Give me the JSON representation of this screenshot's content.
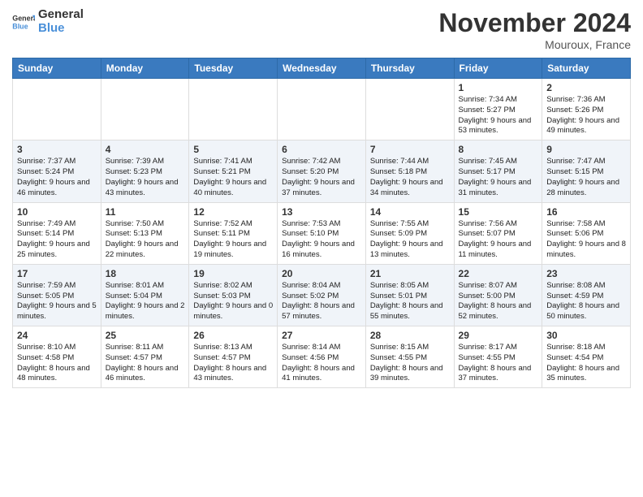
{
  "header": {
    "logo": {
      "general": "General",
      "blue": "Blue"
    },
    "title": "November 2024",
    "location": "Mouroux, France"
  },
  "weekdays": [
    "Sunday",
    "Monday",
    "Tuesday",
    "Wednesday",
    "Thursday",
    "Friday",
    "Saturday"
  ],
  "weeks": [
    {
      "days": [
        null,
        null,
        null,
        null,
        null,
        {
          "num": "1",
          "sunrise": "Sunrise: 7:34 AM",
          "sunset": "Sunset: 5:27 PM",
          "daylight": "Daylight: 9 hours and 53 minutes."
        },
        {
          "num": "2",
          "sunrise": "Sunrise: 7:36 AM",
          "sunset": "Sunset: 5:26 PM",
          "daylight": "Daylight: 9 hours and 49 minutes."
        }
      ]
    },
    {
      "days": [
        {
          "num": "3",
          "sunrise": "Sunrise: 7:37 AM",
          "sunset": "Sunset: 5:24 PM",
          "daylight": "Daylight: 9 hours and 46 minutes."
        },
        {
          "num": "4",
          "sunrise": "Sunrise: 7:39 AM",
          "sunset": "Sunset: 5:23 PM",
          "daylight": "Daylight: 9 hours and 43 minutes."
        },
        {
          "num": "5",
          "sunrise": "Sunrise: 7:41 AM",
          "sunset": "Sunset: 5:21 PM",
          "daylight": "Daylight: 9 hours and 40 minutes."
        },
        {
          "num": "6",
          "sunrise": "Sunrise: 7:42 AM",
          "sunset": "Sunset: 5:20 PM",
          "daylight": "Daylight: 9 hours and 37 minutes."
        },
        {
          "num": "7",
          "sunrise": "Sunrise: 7:44 AM",
          "sunset": "Sunset: 5:18 PM",
          "daylight": "Daylight: 9 hours and 34 minutes."
        },
        {
          "num": "8",
          "sunrise": "Sunrise: 7:45 AM",
          "sunset": "Sunset: 5:17 PM",
          "daylight": "Daylight: 9 hours and 31 minutes."
        },
        {
          "num": "9",
          "sunrise": "Sunrise: 7:47 AM",
          "sunset": "Sunset: 5:15 PM",
          "daylight": "Daylight: 9 hours and 28 minutes."
        }
      ]
    },
    {
      "days": [
        {
          "num": "10",
          "sunrise": "Sunrise: 7:49 AM",
          "sunset": "Sunset: 5:14 PM",
          "daylight": "Daylight: 9 hours and 25 minutes."
        },
        {
          "num": "11",
          "sunrise": "Sunrise: 7:50 AM",
          "sunset": "Sunset: 5:13 PM",
          "daylight": "Daylight: 9 hours and 22 minutes."
        },
        {
          "num": "12",
          "sunrise": "Sunrise: 7:52 AM",
          "sunset": "Sunset: 5:11 PM",
          "daylight": "Daylight: 9 hours and 19 minutes."
        },
        {
          "num": "13",
          "sunrise": "Sunrise: 7:53 AM",
          "sunset": "Sunset: 5:10 PM",
          "daylight": "Daylight: 9 hours and 16 minutes."
        },
        {
          "num": "14",
          "sunrise": "Sunrise: 7:55 AM",
          "sunset": "Sunset: 5:09 PM",
          "daylight": "Daylight: 9 hours and 13 minutes."
        },
        {
          "num": "15",
          "sunrise": "Sunrise: 7:56 AM",
          "sunset": "Sunset: 5:07 PM",
          "daylight": "Daylight: 9 hours and 11 minutes."
        },
        {
          "num": "16",
          "sunrise": "Sunrise: 7:58 AM",
          "sunset": "Sunset: 5:06 PM",
          "daylight": "Daylight: 9 hours and 8 minutes."
        }
      ]
    },
    {
      "days": [
        {
          "num": "17",
          "sunrise": "Sunrise: 7:59 AM",
          "sunset": "Sunset: 5:05 PM",
          "daylight": "Daylight: 9 hours and 5 minutes."
        },
        {
          "num": "18",
          "sunrise": "Sunrise: 8:01 AM",
          "sunset": "Sunset: 5:04 PM",
          "daylight": "Daylight: 9 hours and 2 minutes."
        },
        {
          "num": "19",
          "sunrise": "Sunrise: 8:02 AM",
          "sunset": "Sunset: 5:03 PM",
          "daylight": "Daylight: 9 hours and 0 minutes."
        },
        {
          "num": "20",
          "sunrise": "Sunrise: 8:04 AM",
          "sunset": "Sunset: 5:02 PM",
          "daylight": "Daylight: 8 hours and 57 minutes."
        },
        {
          "num": "21",
          "sunrise": "Sunrise: 8:05 AM",
          "sunset": "Sunset: 5:01 PM",
          "daylight": "Daylight: 8 hours and 55 minutes."
        },
        {
          "num": "22",
          "sunrise": "Sunrise: 8:07 AM",
          "sunset": "Sunset: 5:00 PM",
          "daylight": "Daylight: 8 hours and 52 minutes."
        },
        {
          "num": "23",
          "sunrise": "Sunrise: 8:08 AM",
          "sunset": "Sunset: 4:59 PM",
          "daylight": "Daylight: 8 hours and 50 minutes."
        }
      ]
    },
    {
      "days": [
        {
          "num": "24",
          "sunrise": "Sunrise: 8:10 AM",
          "sunset": "Sunset: 4:58 PM",
          "daylight": "Daylight: 8 hours and 48 minutes."
        },
        {
          "num": "25",
          "sunrise": "Sunrise: 8:11 AM",
          "sunset": "Sunset: 4:57 PM",
          "daylight": "Daylight: 8 hours and 46 minutes."
        },
        {
          "num": "26",
          "sunrise": "Sunrise: 8:13 AM",
          "sunset": "Sunset: 4:57 PM",
          "daylight": "Daylight: 8 hours and 43 minutes."
        },
        {
          "num": "27",
          "sunrise": "Sunrise: 8:14 AM",
          "sunset": "Sunset: 4:56 PM",
          "daylight": "Daylight: 8 hours and 41 minutes."
        },
        {
          "num": "28",
          "sunrise": "Sunrise: 8:15 AM",
          "sunset": "Sunset: 4:55 PM",
          "daylight": "Daylight: 8 hours and 39 minutes."
        },
        {
          "num": "29",
          "sunrise": "Sunrise: 8:17 AM",
          "sunset": "Sunset: 4:55 PM",
          "daylight": "Daylight: 8 hours and 37 minutes."
        },
        {
          "num": "30",
          "sunrise": "Sunrise: 8:18 AM",
          "sunset": "Sunset: 4:54 PM",
          "daylight": "Daylight: 8 hours and 35 minutes."
        }
      ]
    }
  ]
}
